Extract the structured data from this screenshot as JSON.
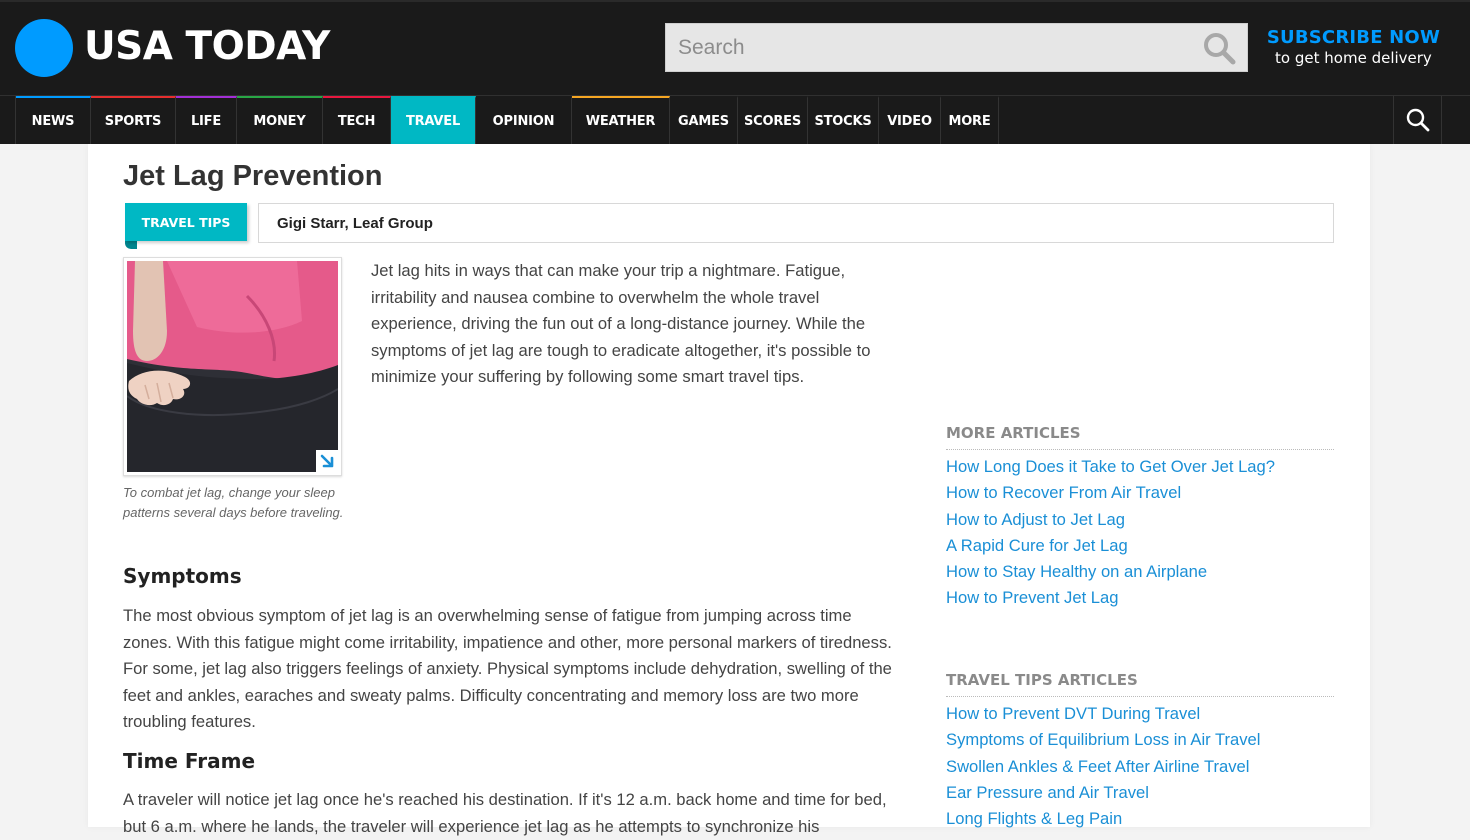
{
  "header": {
    "logo_text": "USA TODAY",
    "search_placeholder": "Search",
    "subscribe_line1": "SUBSCRIBE NOW",
    "subscribe_line2": "to get home delivery"
  },
  "nav": {
    "items": [
      {
        "label": "NEWS",
        "color": "#009bff"
      },
      {
        "label": "SPORTS",
        "color": "#e62e2e"
      },
      {
        "label": "LIFE",
        "color": "#a32fd6"
      },
      {
        "label": "MONEY",
        "color": "#28a745"
      },
      {
        "label": "TECH",
        "color": "#e8173f"
      },
      {
        "label": "TRAVEL",
        "color": "#00b8c4"
      },
      {
        "label": "OPINION",
        "color": "#1a1a1a"
      },
      {
        "label": "WEATHER",
        "color": "#f5a623"
      },
      {
        "label": "GAMES",
        "color": "#1a1a1a"
      },
      {
        "label": "SCORES",
        "color": "#1a1a1a"
      },
      {
        "label": "STOCKS",
        "color": "#1a1a1a"
      },
      {
        "label": "VIDEO",
        "color": "#1a1a1a"
      },
      {
        "label": "MORE",
        "color": "#1a1a1a"
      }
    ],
    "active": "TRAVEL"
  },
  "article": {
    "title": "Jet Lag Prevention",
    "category_tag": "TRAVEL TIPS",
    "byline": "Gigi Starr, Leaf Group",
    "image_caption": "To combat jet lag, change your sleep patterns several days before traveling.",
    "intro": "Jet lag hits in ways that can make your trip a nightmare. Fatigue, irritability and nausea combine to overwhelm the whole travel experience, driving the fun out of a long-distance journey. While the symptoms of jet lag are tough to eradicate altogether, it's possible to minimize your suffering by following some smart travel tips.",
    "sections": [
      {
        "heading": "Symptoms",
        "body": "The most obvious symptom of jet lag is an overwhelming sense of fatigue from jumping across time zones. With this fatigue might come irritability, impatience and other, more personal markers of tiredness. For some, jet lag also triggers feelings of anxiety. Physical symptoms include dehydration, swelling of the feet and ankles, earaches and sweaty palms. Difficulty concentrating and memory loss are two more troubling features."
      },
      {
        "heading": "Time Frame",
        "body": "A traveler will notice jet lag once he's reached his destination. If it's 12 a.m. back home and time for bed, but 6 a.m. where he lands, the traveler will experience jet lag as he attempts to synchronize his"
      }
    ]
  },
  "sidebar": {
    "more_articles_title": "MORE ARTICLES",
    "more_articles": [
      "How Long Does it Take to Get Over Jet Lag?",
      "How to Recover From Air Travel",
      "How to Adjust to Jet Lag",
      "A Rapid Cure for Jet Lag",
      "How to Stay Healthy on an Airplane",
      "How to Prevent Jet Lag"
    ],
    "travel_tips_title": "TRAVEL TIPS ARTICLES",
    "travel_tips": [
      "How to Prevent DVT During Travel",
      "Symptoms of Equilibrium Loss in Air Travel",
      "Swollen Ankles & Feet After Airline Travel",
      "Ear Pressure and Air Travel",
      "Long Flights & Leg Pain"
    ]
  },
  "colors": {
    "brand_blue": "#009bff",
    "travel_teal": "#00b8c4",
    "link_blue": "#1a8fd6",
    "header_bg": "#1a1a1a"
  }
}
